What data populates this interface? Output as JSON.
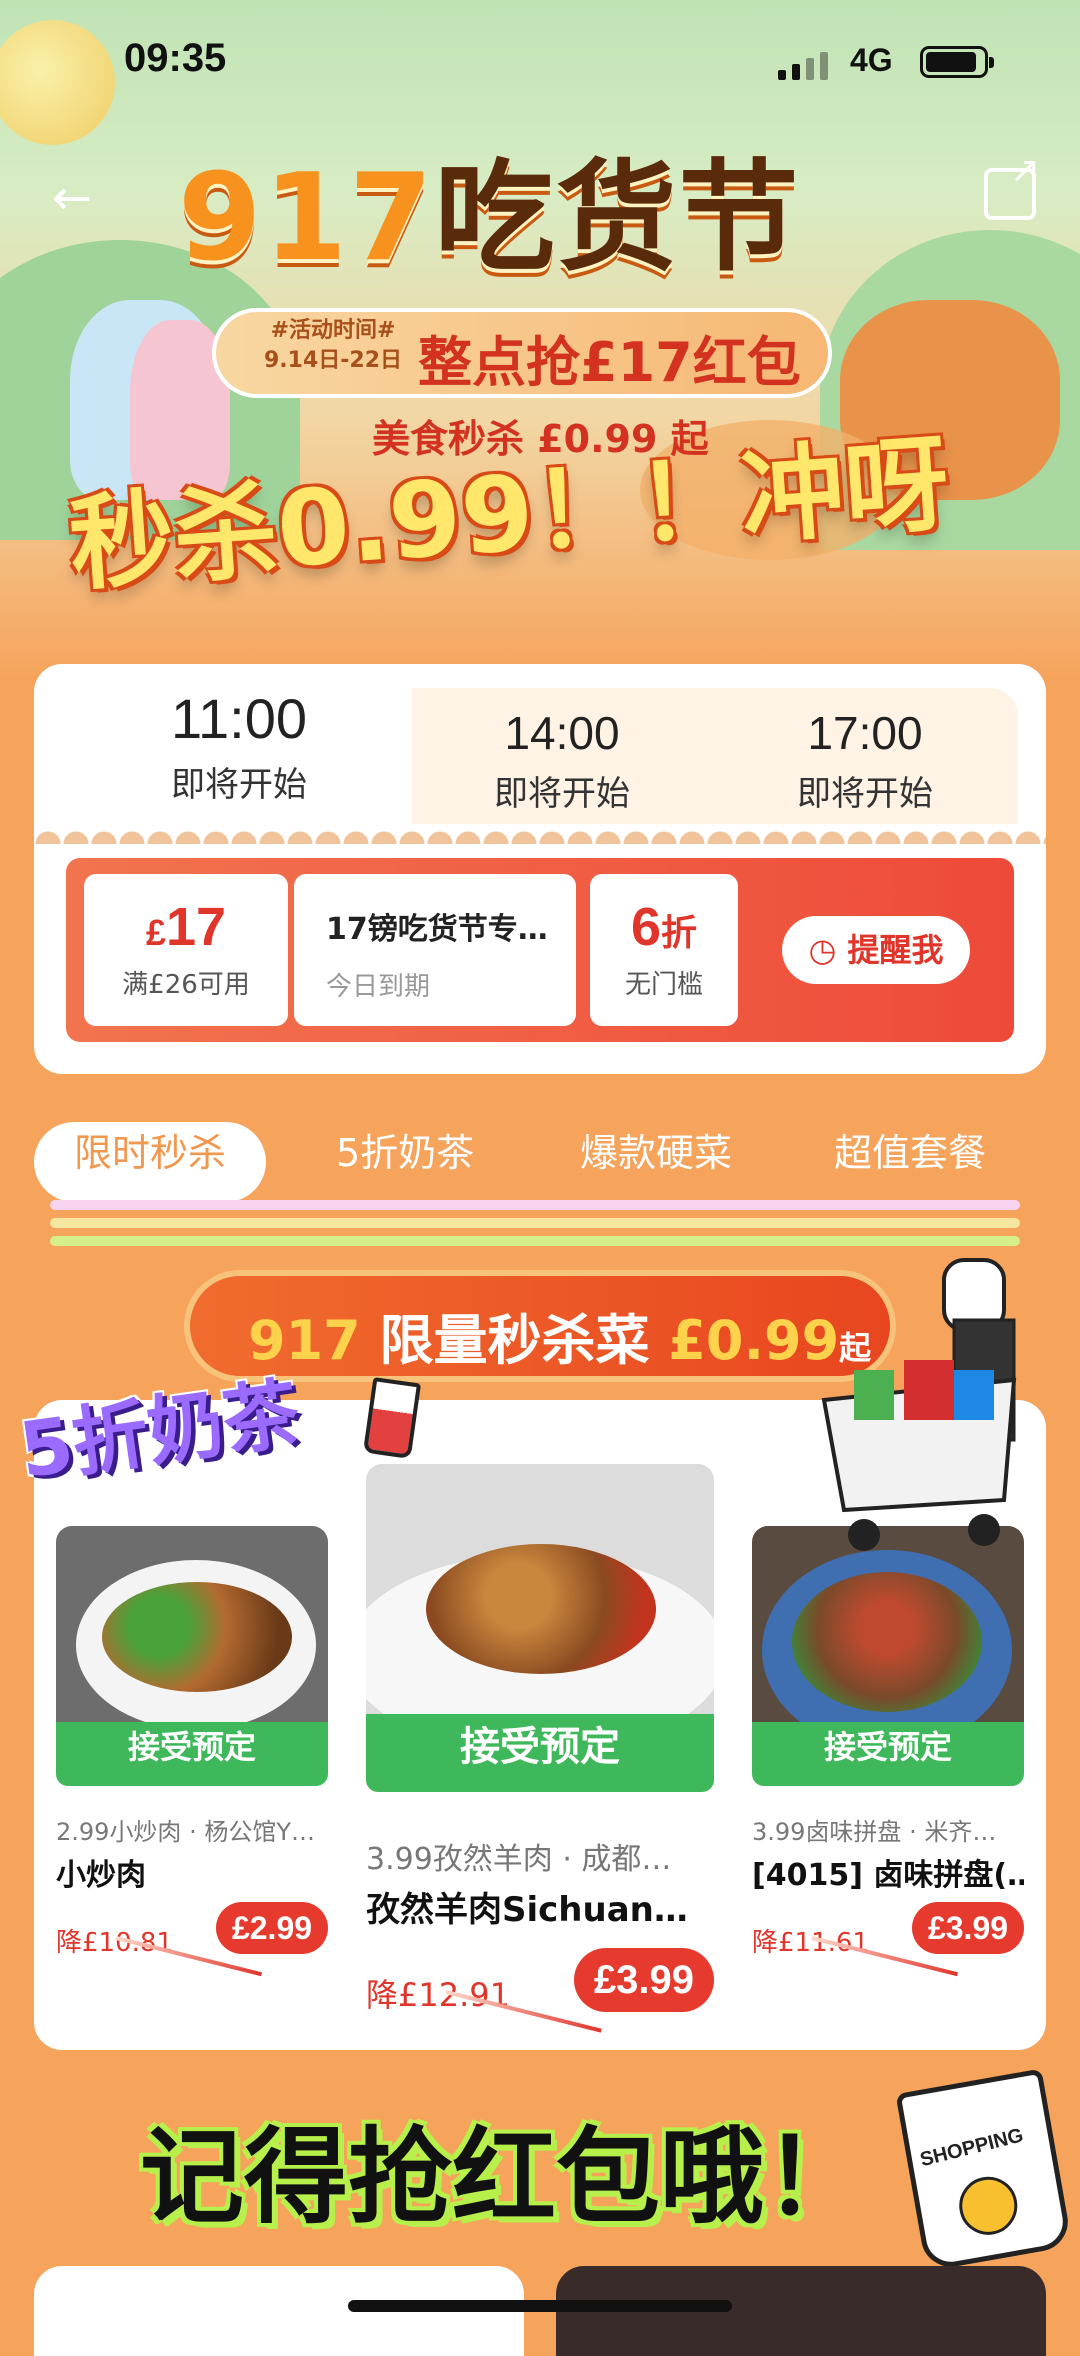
{
  "status_bar": {
    "time": "09:35",
    "network": "4G"
  },
  "hero": {
    "title_num": "917",
    "title_text": "吃货节",
    "activity_tag": "#活动时间#",
    "activity_dates": "9.14日-22日",
    "activity_main": "整点抢£17红包",
    "seckill_line": "美食秒杀 £0.99 起",
    "slogan": "秒杀0.99！！冲呀"
  },
  "time_tabs": [
    {
      "time": "11:00",
      "status": "即将开始"
    },
    {
      "time": "14:00",
      "status": "即将开始"
    },
    {
      "time": "17:00",
      "status": "即将开始"
    }
  ],
  "coupons": {
    "c1": {
      "currency": "£",
      "amount": "17",
      "condition": "满£26可用"
    },
    "c2": {
      "name": "17镑吃货节专…",
      "expiry": "今日到期"
    },
    "c3": {
      "amount": "6",
      "unit": "折",
      "condition": "无门槛"
    },
    "remind_label": "提醒我"
  },
  "category_tabs": [
    "限时秒杀",
    "5折奶茶",
    "爆款硬菜",
    "超值套餐"
  ],
  "banner": {
    "num": "917",
    "text": "限量秒杀菜",
    "price": "£0.99",
    "suffix": "起"
  },
  "sticker": {
    "tea": "5折奶茶"
  },
  "products": [
    {
      "reserve": "接受预定",
      "shop": "2.99小炒肉 · 杨公馆Y…",
      "name": "小炒肉",
      "save": "降£10.81",
      "price": "£2.99"
    },
    {
      "reserve": "接受预定",
      "shop": "3.99孜然羊肉 · 成都…",
      "name": "孜然羊肉Sichuan…",
      "save": "降£12.91",
      "price": "£3.99"
    },
    {
      "reserve": "接受预定",
      "shop": "3.99卤味拼盘 · 米齐…",
      "name": "[4015] 卤味拼盘(…",
      "save": "降£11.61",
      "price": "£3.99"
    }
  ],
  "footer": {
    "remember": "记得抢红包哦！",
    "bag_label": "SHOPPING"
  },
  "colors": {
    "accent_orange": "#f6a35c",
    "red": "#e0352b",
    "green": "#3fb85b"
  }
}
